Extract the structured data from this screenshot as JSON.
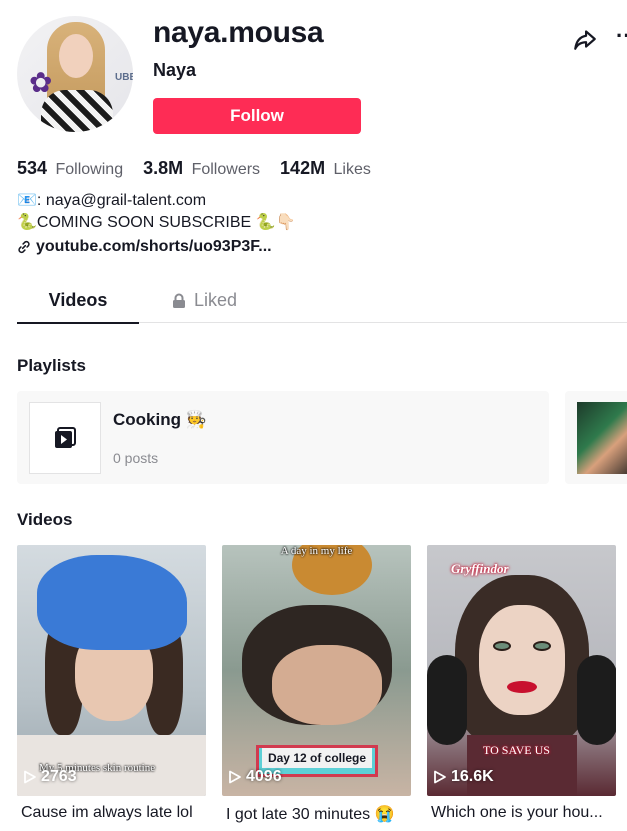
{
  "profile": {
    "username": "naya.mousa",
    "nickname": "Naya",
    "follow_label": "Follow",
    "avatar_badge": "UBER"
  },
  "stats": {
    "following_count": "534",
    "following_label": "Following",
    "followers_count": "3.8M",
    "followers_label": "Followers",
    "likes_count": "142M",
    "likes_label": "Likes"
  },
  "bio": {
    "line1": "📧: naya@grail-talent.com",
    "line2": "🐍COMING SOON SUBSCRIBE 🐍👇🏻",
    "link": "youtube.com/shorts/uo93P3F..."
  },
  "tabs": {
    "videos": "Videos",
    "liked": "Liked"
  },
  "playlists": {
    "title": "Playlists",
    "items": [
      {
        "name": "Cooking 🧑‍🍳",
        "count": "0 posts"
      }
    ]
  },
  "videos": {
    "title": "Videos",
    "items": [
      {
        "views": "2763",
        "caption": "Cause im always late lol",
        "overlay_bottom": "My 5 minutes skin routine"
      },
      {
        "views": "4096",
        "caption": "I got late 30 minutes 😭",
        "overlay_top": "A day in my life",
        "banner": "Day 12 of college"
      },
      {
        "views": "16.6K",
        "caption": "Which one is your hou...",
        "overlay_top": "Gryffindor",
        "overlay_bottom": "TO SAVE US"
      }
    ]
  },
  "colors": {
    "brand": "#fe2c55",
    "text": "#161823",
    "muted": "#8a8b91"
  }
}
